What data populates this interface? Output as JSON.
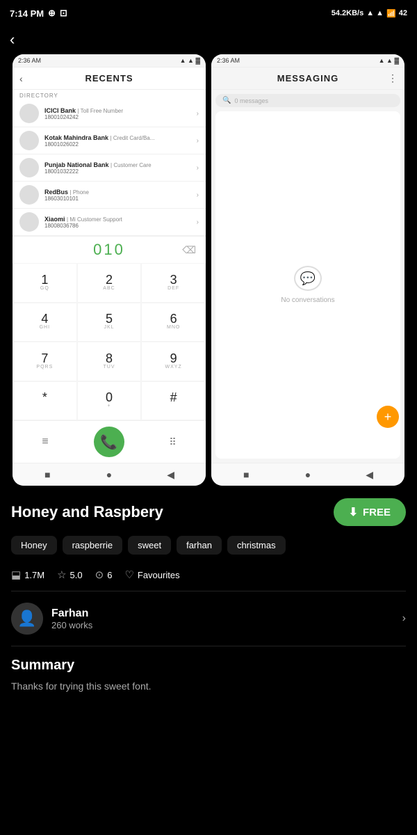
{
  "statusBar": {
    "time": "7:14 PM",
    "speed": "54.2KB/s",
    "battery": "42"
  },
  "phoneScreenLeft": {
    "statusTime": "2:36 AM",
    "headerTitle": "Recents",
    "directoryLabel": "DIRECTORY",
    "contacts": [
      {
        "name": "ICICI Bank",
        "tag": "Toll Free Number",
        "number": "18001024242"
      },
      {
        "name": "Kotak Mahindra Bank",
        "tag": "Credit Card/Ba...",
        "number": "18001026022"
      },
      {
        "name": "Punjab National Bank",
        "tag": "Customer Care",
        "number": "18001032222"
      },
      {
        "name": "RedBus",
        "tag": "Phone",
        "number": "18603010101"
      },
      {
        "name": "Xiaomi",
        "tag": "Mi Customer Support",
        "number": "18008036786"
      }
    ],
    "dialNumber": "010",
    "keypad": [
      {
        "digit": "1",
        "letters": "GQ"
      },
      {
        "digit": "2",
        "letters": "ABC"
      },
      {
        "digit": "3",
        "letters": "DEF"
      },
      {
        "digit": "4",
        "letters": "GHI"
      },
      {
        "digit": "5",
        "letters": "JKL"
      },
      {
        "digit": "6",
        "letters": "MNO"
      },
      {
        "digit": "7",
        "letters": "PQRS"
      },
      {
        "digit": "8",
        "letters": "TUV"
      },
      {
        "digit": "9",
        "letters": "WXYZ"
      },
      {
        "digit": "*",
        "letters": ""
      },
      {
        "digit": "0",
        "letters": "+"
      },
      {
        "digit": "#",
        "letters": ""
      }
    ]
  },
  "phoneScreenRight": {
    "statusTime": "2:36 AM",
    "headerTitle": "Messaging",
    "searchPlaceholder": "0 messages",
    "noConversationsText": "No conversations"
  },
  "app": {
    "title": "Honey and Raspbery",
    "freeButton": "FREE",
    "tags": [
      "Honey",
      "raspberrie",
      "sweet",
      "farhan",
      "christmas"
    ],
    "stats": {
      "downloads": "1.7M",
      "rating": "5.0",
      "comments": "6",
      "favouritesLabel": "Favourites"
    },
    "author": {
      "name": "Farhan",
      "works": "260 works"
    },
    "summary": {
      "title": "Summary",
      "text": "Thanks for trying this sweet font."
    }
  }
}
